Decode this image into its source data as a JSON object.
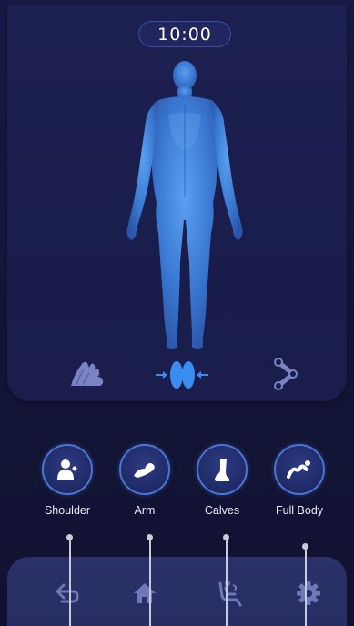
{
  "timer": {
    "value": "10:00"
  },
  "functions": [
    {
      "label": "Shoulder",
      "icon": "shoulder-icon"
    },
    {
      "label": "Arm",
      "icon": "arm-icon"
    },
    {
      "label": "Calves",
      "icon": "calves-icon"
    },
    {
      "label": "Full Body",
      "icon": "full-body-icon"
    }
  ],
  "mode_icons": [
    "hand-massage-icon",
    "foot-pressure-icon",
    "roller-icon"
  ],
  "nav": [
    "back-icon",
    "home-icon",
    "massage-chair-icon",
    "settings-icon"
  ],
  "colors": {
    "background": "#14153a",
    "panel": "#1c2050",
    "accent": "#4a76d4",
    "figure": "#3f7fd8",
    "active_icon": "#3a8cf0",
    "inactive_icon": "#6f78b8"
  }
}
